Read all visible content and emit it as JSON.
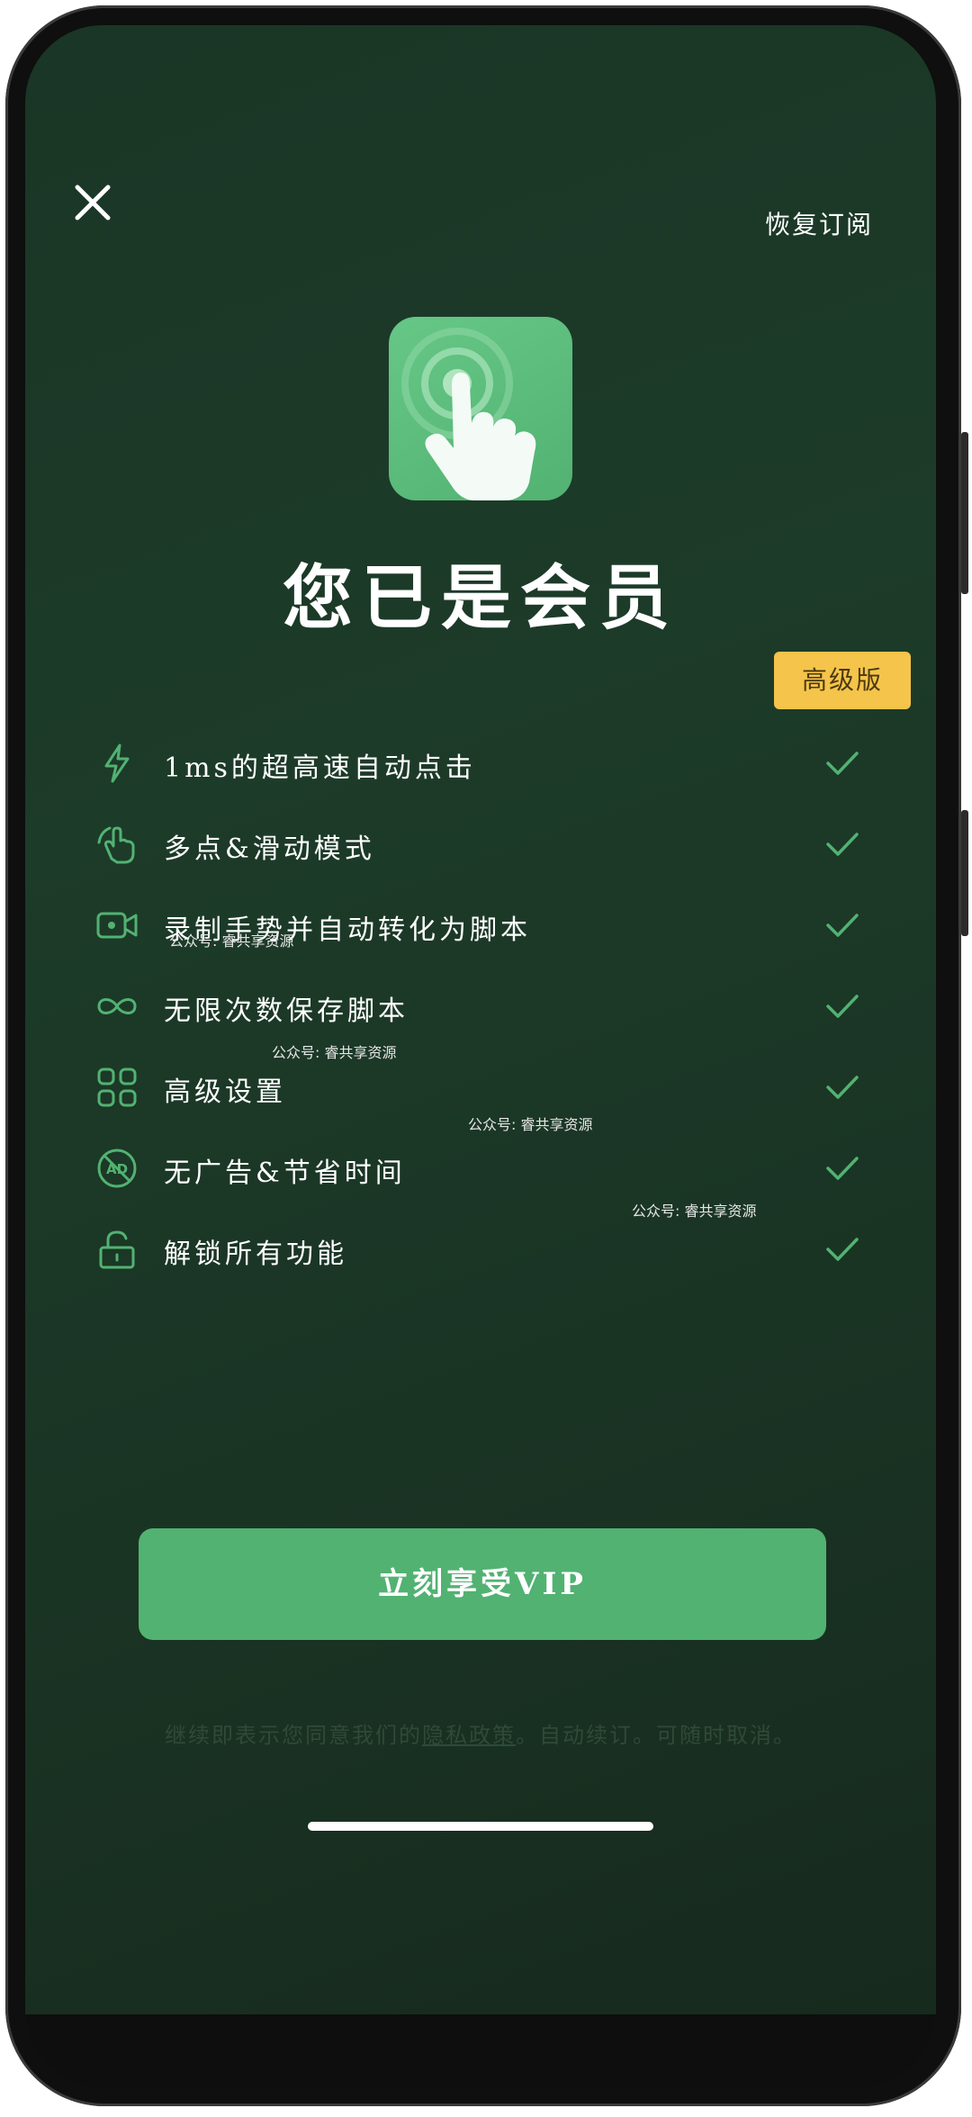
{
  "header": {
    "close_icon": "close-icon",
    "restore_label": "恢复订阅"
  },
  "app": {
    "icon": "tap-hand-icon",
    "accent_color": "#52b272",
    "title": "您已是会员"
  },
  "badge": {
    "label": "高级版",
    "color": "#f5c44a"
  },
  "features": [
    {
      "icon": "lightning-icon",
      "label": "1ms的超高速自动点击",
      "included": true
    },
    {
      "icon": "multi-touch-hand-icon",
      "label": "多点&滑动模式",
      "included": true
    },
    {
      "icon": "video-record-icon",
      "label": "录制手势并自动转化为脚本",
      "included": true
    },
    {
      "icon": "infinity-icon",
      "label": "无限次数保存脚本",
      "included": true
    },
    {
      "icon": "grid-settings-icon",
      "label": "高级设置",
      "included": true
    },
    {
      "icon": "no-ads-icon",
      "label": "无广告&节省时间",
      "included": true
    },
    {
      "icon": "unlock-icon",
      "label": "解锁所有功能",
      "included": true
    }
  ],
  "watermarks": [
    "公众号: 睿共享资源",
    "公众号: 睿共享资源",
    "公众号: 睿共享资源",
    "公众号: 睿共享资源"
  ],
  "cta": {
    "label": "立刻享受VIP"
  },
  "footer": {
    "prefix": "继续即表示您同意我们的",
    "privacy_link": "隐私政策",
    "suffix": "。自动续订。可随时取消。"
  },
  "colors": {
    "background": "#1b3827",
    "check": "#52b272"
  }
}
